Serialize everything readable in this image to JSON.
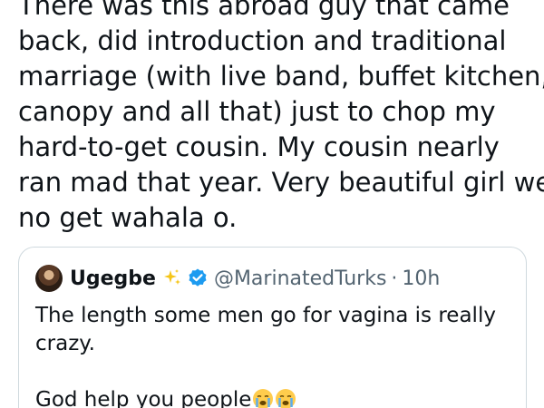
{
  "tweet": {
    "lines": [
      "There was this abroad guy that came",
      "back, did introduction and traditional",
      "marriage (with live band, buffet kitchen,",
      "canopy and all that) just to chop my",
      "hard-to-get cousin. My cousin nearly",
      "ran mad that year. Very beautiful girl wey",
      "no get wahala o."
    ]
  },
  "quote": {
    "display_name": "Ugegbe",
    "name_emoji": "sparkles-icon",
    "verified_icon": "verified-badge-icon",
    "handle": "@MarinatedTurks",
    "separator": "·",
    "time": "10h",
    "text_line1": "The length some men go for vagina is really",
    "text_line2": "crazy.",
    "text_line3": "God help you people",
    "trailing_emojis": [
      "loudly-crying-face-icon",
      "loudly-crying-face-icon"
    ]
  },
  "colors": {
    "text_primary": "#0f1419",
    "text_secondary": "#536471",
    "verified_blue": "#1d9bf0",
    "border": "#cfd9de"
  }
}
